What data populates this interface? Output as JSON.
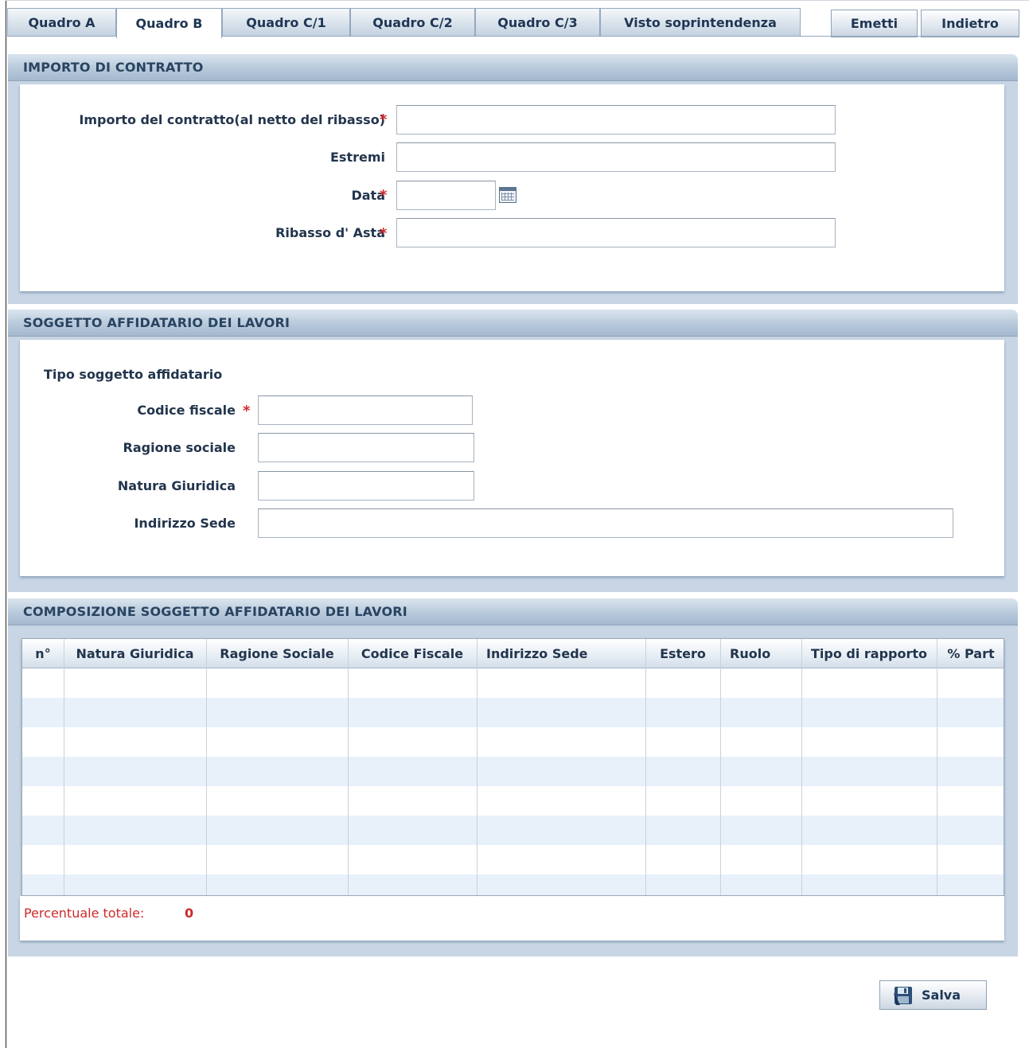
{
  "tabs": [
    {
      "label": "Quadro A",
      "active": false
    },
    {
      "label": "Quadro B",
      "active": true
    },
    {
      "label": "Quadro C/1",
      "active": false
    },
    {
      "label": "Quadro C/2",
      "active": false
    },
    {
      "label": "Quadro C/3",
      "active": false
    },
    {
      "label": "Visto soprintendenza",
      "active": false
    }
  ],
  "actions": {
    "emit_label": "Emetti",
    "back_label": "Indietro"
  },
  "contract_section": {
    "title": "IMPORTO DI CONTRATTO",
    "fields": {
      "importo": {
        "label": "Importo del contratto(al netto del ribasso)",
        "value": "",
        "required": true
      },
      "estremi": {
        "label": "Estremi",
        "value": "",
        "required": false
      },
      "data": {
        "label": "Data",
        "value": "",
        "required": true
      },
      "ribasso": {
        "label": "Ribasso d' Asta",
        "value": "",
        "required": true
      }
    }
  },
  "contractor_section": {
    "title": "SOGGETTO AFFIDATARIO DEI LAVORI",
    "tipo_label": "Tipo soggetto affidatario",
    "fields": {
      "codice_fiscale": {
        "label": "Codice fiscale",
        "value": "",
        "required": true
      },
      "ragione_sociale": {
        "label": "Ragione sociale",
        "value": ""
      },
      "natura_giuridica": {
        "label": "Natura Giuridica",
        "value": ""
      },
      "indirizzo_sede": {
        "label": "Indirizzo Sede",
        "value": ""
      }
    }
  },
  "composition_section": {
    "title": "COMPOSIZIONE SOGGETTO AFFIDATARIO DEI LAVORI",
    "columns": [
      "n°",
      "Natura Giuridica",
      "Ragione Sociale",
      "Codice Fiscale",
      "Indirizzo Sede",
      "Estero",
      "Ruolo",
      "Tipo di rapporto",
      "% Part"
    ],
    "rows": [],
    "total_label": "Percentuale totale:",
    "total_value": "0"
  },
  "save_label": "Salva",
  "colors": {
    "required": "#d42a2a",
    "panel_header": "#b8c9db",
    "alt_row": "#e8f0fa"
  }
}
